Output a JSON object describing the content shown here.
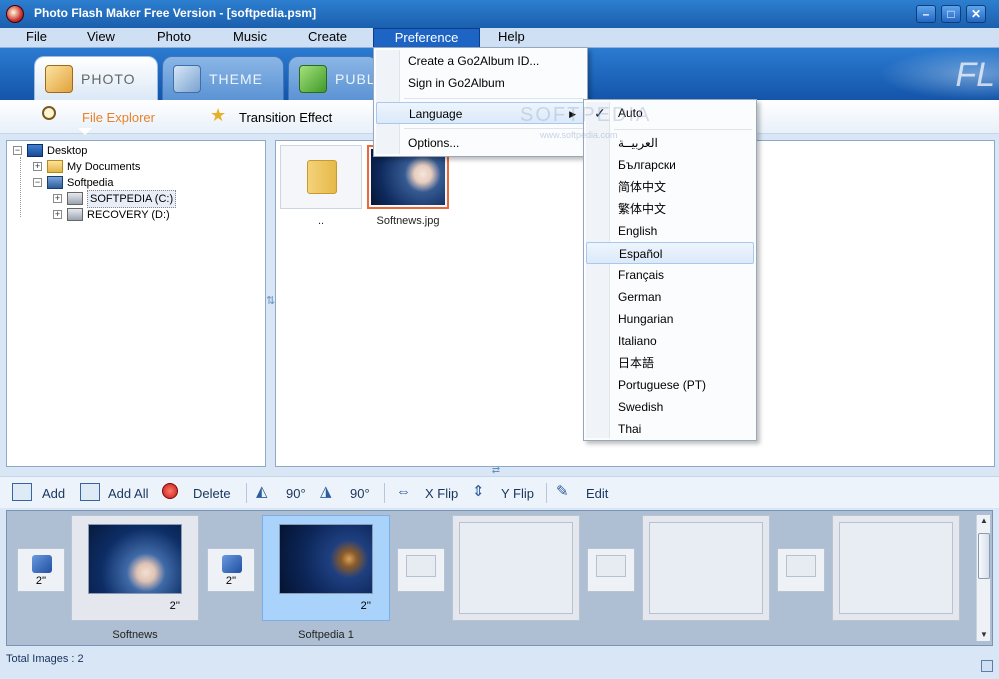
{
  "window": {
    "title": "Photo Flash Maker Free Version - [softpedia.psm]"
  },
  "menubar": {
    "file": "File",
    "view": "View",
    "photo": "Photo",
    "music": "Music",
    "create": "Create",
    "preference": "Preference",
    "help": "Help"
  },
  "tabs": {
    "photo": "PHOTO",
    "theme": "THEME",
    "publish": "PUBLI",
    "deco": "FL"
  },
  "subbar": {
    "file_explorer": "File Explorer",
    "transition_effect": "Transition Effect"
  },
  "tree": {
    "desktop": "Desktop",
    "my_documents": "My Documents",
    "softpedia": "Softpedia",
    "drive_c": "SOFTPEDIA (C:)",
    "drive_d": "RECOVERY (D:)"
  },
  "files": {
    "items": [
      {
        "caption": ".."
      },
      {
        "caption": "Softnews.jpg"
      }
    ]
  },
  "toolbar": {
    "add": "Add",
    "add_all": "Add All",
    "delete": "Delete",
    "rot_left": "90°",
    "rot_right": "90°",
    "x_flip": "X Flip",
    "y_flip": "Y Flip",
    "edit": "Edit"
  },
  "storyboard": {
    "transitions": [
      "2''",
      "2''"
    ],
    "slides": [
      {
        "caption": "Softnews",
        "duration": "2''"
      },
      {
        "caption": "Softpedia 1",
        "duration": "2''"
      }
    ]
  },
  "status": {
    "total": "Total Images : 2"
  },
  "preference_menu": {
    "create_id": "Create a Go2Album ID...",
    "sign_in": "Sign in Go2Album",
    "language": "Language",
    "options": "Options..."
  },
  "language_menu": {
    "auto": "Auto",
    "items": [
      "العربيــة",
      "Български",
      "简体中文",
      "繁体中文",
      "English",
      "Español",
      "Français",
      "German",
      "Hungarian",
      "Italiano",
      "日本語",
      "Portuguese (PT)",
      "Swedish",
      "Thai"
    ],
    "selected": "Español",
    "checked": "Auto"
  },
  "watermark": {
    "text": "SOFTPEDIA",
    "sub": "www.softpedia.com"
  },
  "colors": {
    "title_bar": "#1b5fae",
    "menu_active": "#1d64c4",
    "tab_active_text": "#e8822a",
    "storyboard_bg": "#aebfd3",
    "selected_slide": "#a9d3fb"
  }
}
